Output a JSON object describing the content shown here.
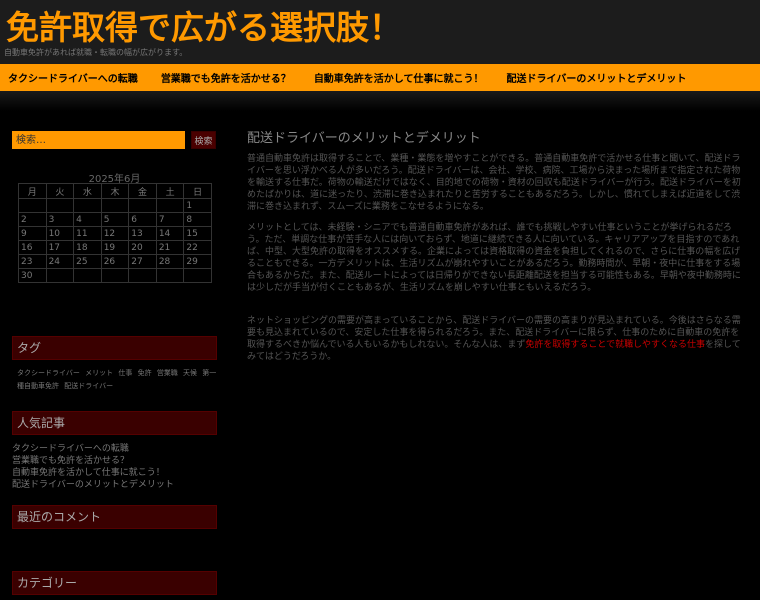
{
  "header": {
    "title": "免許取得で広がる選択肢！",
    "description": "自動車免許があれば就職・転職の幅が広がります。"
  },
  "nav": [
    "タクシードライバーへの転職",
    "営業職でも免許を活かせる？",
    "自動車免許を活かして仕事に就こう！",
    "配送ドライバーのメリットとデメリット"
  ],
  "search": {
    "placeholder": "検索…",
    "button": "検索"
  },
  "calendar": {
    "caption": "2025年6月",
    "weekdays": [
      "月",
      "火",
      "水",
      "木",
      "金",
      "土",
      "日"
    ],
    "weeks": [
      [
        "",
        "",
        "",
        "",
        "",
        "",
        "1"
      ],
      [
        "2",
        "3",
        "4",
        "5",
        "6",
        "7",
        "8"
      ],
      [
        "9",
        "10",
        "11",
        "12",
        "13",
        "14",
        "15"
      ],
      [
        "16",
        "17",
        "18",
        "19",
        "20",
        "21",
        "22"
      ],
      [
        "23",
        "24",
        "25",
        "26",
        "27",
        "28",
        "29"
      ],
      [
        "30",
        "",
        "",
        "",
        "",
        "",
        ""
      ]
    ]
  },
  "widgets": {
    "tags_title": "タグ",
    "tags": [
      "タクシードライバー",
      "メリット",
      "仕事",
      "免許",
      "営業職",
      "天候",
      "第一種自動車免許",
      "配送ドライバー"
    ],
    "popular_title": "人気記事",
    "popular": [
      "タクシードライバーへの転職",
      "営業職でも免許を活かせる？",
      "自動車免許を活かして仕事に就こう！",
      "配送ドライバーのメリットとデメリット"
    ],
    "comments_title": "最近のコメント",
    "categories_title": "カテゴリー"
  },
  "post": {
    "title": "配送ドライバーのメリットとデメリット",
    "p1": "普通自動車免許は取得することで、業種・業態を増やすことができる。普通自動車免許で活かせる仕事と聞いて、配送ドライバーを思い浮かべる人が多いだろう。配送ドライバーは、会社、学校、病院、工場から決まった場所まで指定された荷物を輸送する仕事だ。荷物の輸送だけではなく、目的地での荷物・資材の回収も配送ドライバーが行う。配送ドライバーを初めたばかりは、道に迷ったり、渋滞に巻き込まれたりと苦労することもあるだろう。しかし、慣れてしまえば近道をして渋滞に巻き込まれず、スムーズに業務をこなせるようになる。",
    "p2": "メリットとしては、未経験・シニアでも普通自動車免許があれば、誰でも挑戦しやすい仕事ということが挙げられるだろう。ただ、単調な仕事が苦手な人には向いておらず、地道に継続できる人に向いている。キャリアアップを目指すのであれば、中型、大型免許の取得をオススメする。企業によっては資格取得の資金を負担してくれるので、さらに仕事の幅を広げることもできる。一方デメリットは、生活リズムが崩れやすいことがあるだろう。勤務時間が、早朝・夜中に仕事をする場合もあるからだ。また、配送ルートによっては日帰りができない長距離配送を担当する可能性もある。早朝や夜中勤務時には少しだが手当が付くこともあるが、生活リズムを崩しやすい仕事ともいえるだろう。",
    "p3_before": "ネットショッピングの需要が高まっていることから、配送ドライバーの需要の高まりが見込まれている。今後はさらなる需要も見込まれているので、安定した仕事を得られるだろう。また、配送ドライバーに限らず、仕事のために自動車の免許を取得するべきか悩んでいる人もいるかもしれない。そんな人は、まず",
    "p3_link": "免許を取得することで就職しやすくなる仕事",
    "p3_after": "を探してみてはどうだろうか。"
  }
}
